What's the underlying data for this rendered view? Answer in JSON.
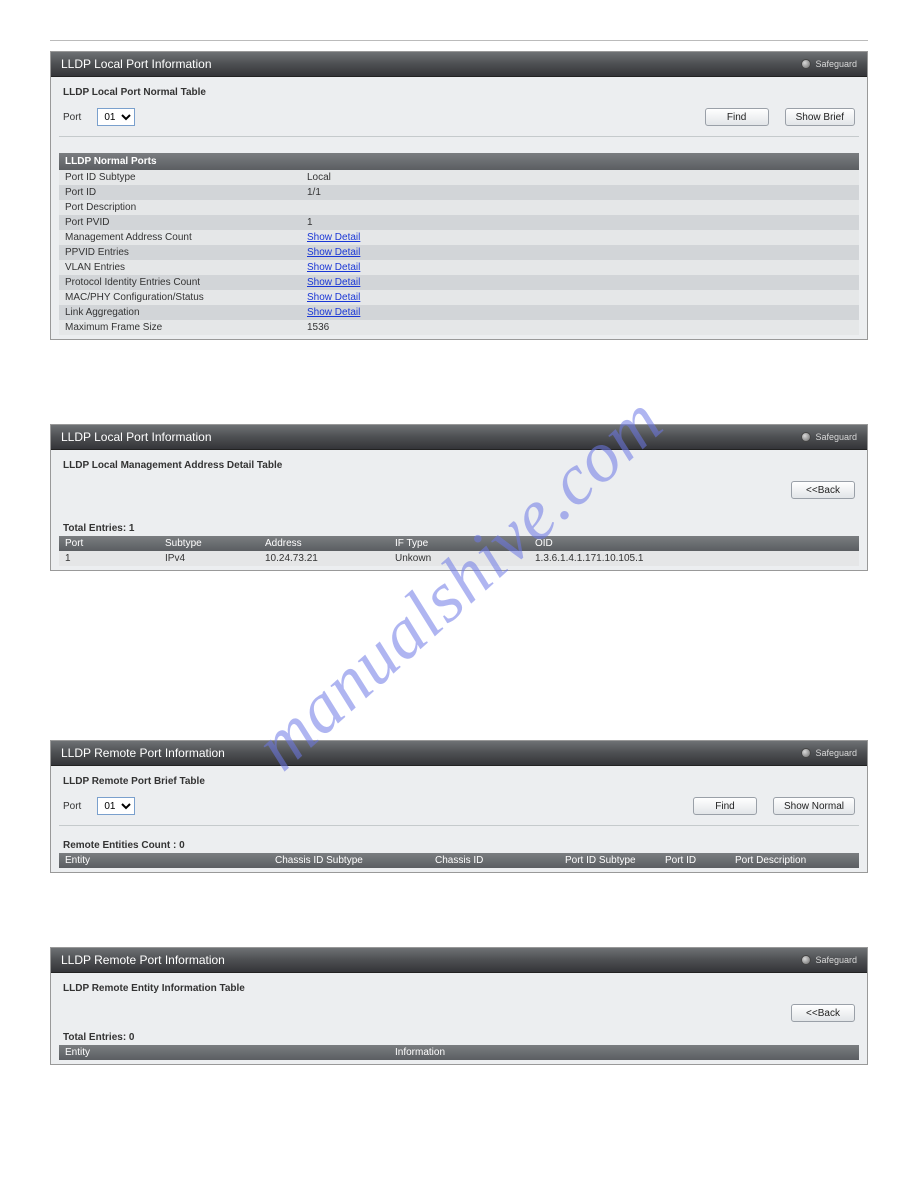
{
  "safeguard": "Safeguard",
  "buttons": {
    "find": "Find",
    "show_brief": "Show Brief",
    "show_normal": "Show Normal",
    "back": "<<Back"
  },
  "port_label": "Port",
  "port_value": "01",
  "panel1": {
    "title": "LLDP Local Port Information",
    "sub": "LLDP Local Port Normal Table",
    "section": "LLDP Normal Ports",
    "rows": [
      {
        "k": "Port ID Subtype",
        "v": "Local"
      },
      {
        "k": "Port ID",
        "v": "1/1"
      },
      {
        "k": "Port Description",
        "v": ""
      },
      {
        "k": "Port PVID",
        "v": "1"
      },
      {
        "k": "Management Address Count",
        "v": "Show Detail",
        "link": true
      },
      {
        "k": "PPVID Entries",
        "v": "Show Detail",
        "link": true
      },
      {
        "k": "VLAN Entries",
        "v": "Show Detail",
        "link": true
      },
      {
        "k": "Protocol Identity Entries Count",
        "v": "Show Detail",
        "link": true
      },
      {
        "k": "MAC/PHY Configuration/Status",
        "v": "Show Detail",
        "link": true
      },
      {
        "k": "Link Aggregation",
        "v": "Show Detail",
        "link": true
      },
      {
        "k": "Maximum Frame Size",
        "v": "1536"
      }
    ]
  },
  "panel2": {
    "title": "LLDP Local Port Information",
    "sub": "LLDP Local Management Address Detail Table",
    "total": "Total Entries: 1",
    "head": {
      "port": "Port",
      "subtype": "Subtype",
      "addr": "Address",
      "iftype": "IF Type",
      "oid": "OID"
    },
    "row": {
      "port": "1",
      "subtype": "IPv4",
      "addr": "10.24.73.21",
      "iftype": "Unkown",
      "oid": "1.3.6.1.4.1.171.10.105.1"
    }
  },
  "panel3": {
    "title": "LLDP Remote Port Information",
    "sub": "LLDP Remote Port Brief Table",
    "count": "Remote Entities Count  :  0",
    "head": {
      "entity": "Entity",
      "cidsub": "Chassis ID Subtype",
      "cid": "Chassis ID",
      "pidsub": "Port ID Subtype",
      "pid": "Port ID",
      "pdesc": "Port Description"
    }
  },
  "panel4": {
    "title": "LLDP Remote Port Information",
    "sub": "LLDP Remote Entity Information Table",
    "total": "Total Entries: 0",
    "head": {
      "entity": "Entity",
      "info": "Information"
    }
  },
  "watermark": "manualshive.com"
}
